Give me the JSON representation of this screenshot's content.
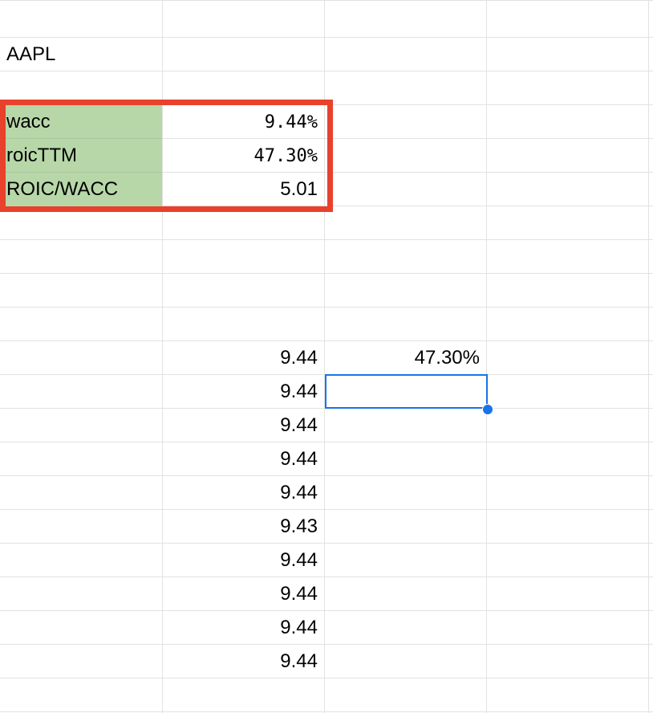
{
  "sheet": {
    "ticker": "AAPL",
    "metrics": [
      {
        "label": "wacc",
        "value": "9.44%"
      },
      {
        "label": "roicTTM",
        "value": "47.30%"
      },
      {
        "label": "ROIC/WACC",
        "value": "5.01"
      }
    ],
    "column_b_values": [
      "9.44",
      "9.44",
      "9.44",
      "9.44",
      "9.44",
      "9.43",
      "9.44",
      "9.44",
      "9.44",
      "9.44"
    ],
    "column_c_value": "47.30%"
  },
  "colors": {
    "gridline": "#e2e2e2",
    "label_fill": "#b7d7a8",
    "highlight_border": "#e8412c",
    "selection": "#1a73e8"
  }
}
